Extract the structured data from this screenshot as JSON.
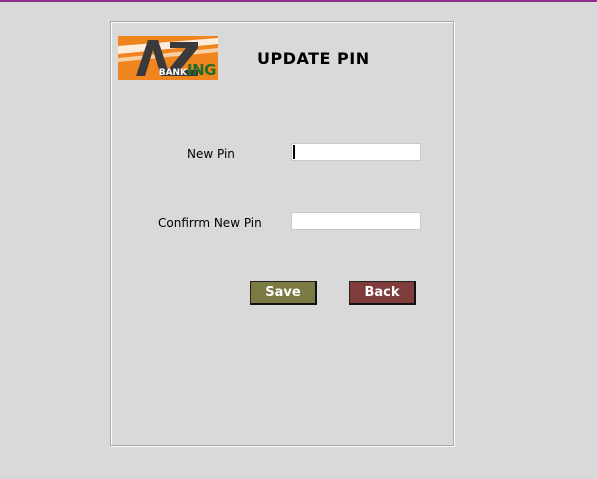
{
  "colors": {
    "top_line": "#8b2f8b",
    "save_button": "#7a7a42",
    "back_button": "#7e3d3a",
    "logo_background": "#f0841e",
    "logo_ing": "#1f6d2a"
  },
  "logo": {
    "text_small": "BANK",
    "text_big": "ING",
    "mark": "AZ"
  },
  "page": {
    "title": "UPDATE PIN"
  },
  "form": {
    "new_pin_label": "New Pin",
    "new_pin_value": "",
    "confirm_pin_label": "Confirrm New Pin",
    "confirm_pin_value": ""
  },
  "buttons": {
    "save_label": "Save",
    "back_label": "Back"
  }
}
